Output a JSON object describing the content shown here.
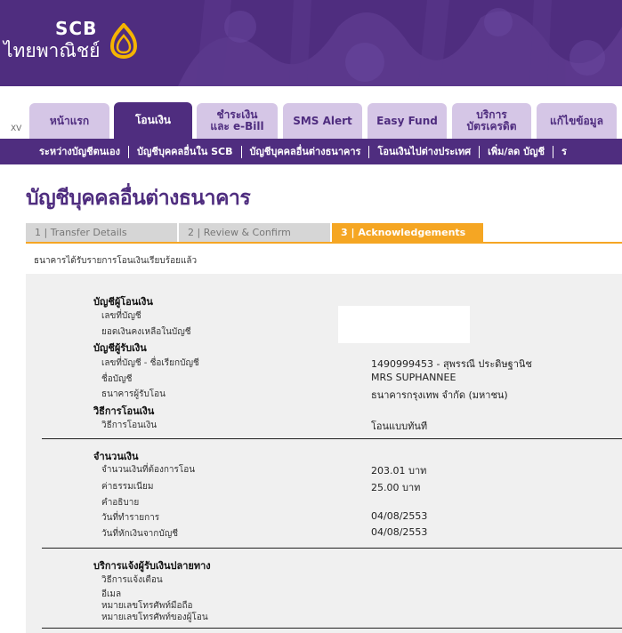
{
  "brand": {
    "name_en": "SCB",
    "name_th": "ไทยพาณิชย์",
    "purple": "#4f2d7f",
    "light_purple": "#d5c6e6",
    "orange": "#f5a623"
  },
  "tabbar": {
    "xv": "XV",
    "tabs": [
      {
        "label": "หน้าแรก"
      },
      {
        "label": "โอนเงิน"
      },
      {
        "label_line1": "ชำระเงิน",
        "label_line2": "และ e-Bill"
      },
      {
        "label": "SMS Alert"
      },
      {
        "label": "Easy Fund"
      },
      {
        "label_line1": "บริการ",
        "label_line2": "บัตรเครดิต"
      },
      {
        "label": "แก้ไขข้อมูล"
      }
    ]
  },
  "subnav": {
    "items": [
      "ระหว่างบัญชีตนเอง",
      "บัญชีบุคคลอื่นใน SCB",
      "บัญชีบุคคลอื่นต่างธนาคาร",
      "โอนเงินไปต่างประเทศ",
      "เพิ่ม/ลด บัญชี",
      "ร"
    ]
  },
  "page": {
    "title": "บัญชีบุคคลอื่นต่างธนาคาร",
    "steps": [
      "1 | Transfer Details",
      "2 | Review & Confirm",
      "3 | Acknowledgements"
    ],
    "ack_message": "ธนาคารได้รับรายการโอนเงินเรียบร้อยแล้ว"
  },
  "from_account": {
    "title": "บัญชีผู้โอนเงิน",
    "account_no_label": "เลขที่บัญชี",
    "balance_label": "ยอดเงินคงเหลือในบัญชี"
  },
  "to_account": {
    "title": "บัญชีผู้รับเงิน",
    "account_no_label": "เลขที่บัญชี - ชื่อเรียกบัญชี",
    "account_no_value": "1490999453 - สุพรรณี ประดิษฐานิช",
    "account_name_label": "ชื่อบัญชี",
    "account_name_value": "MRS SUPHANNEE",
    "bank_label": "ธนาคารผู้รับโอน",
    "bank_value": "ธนาคารกรุงเทพ จำกัด (มหาชน)"
  },
  "method": {
    "title": "วิธีการโอนเงิน",
    "label": "วิธีการโอนเงิน",
    "value": "โอนแบบทันที"
  },
  "amount": {
    "title": "จำนวนเงิน",
    "amount_label": "จำนวนเงินที่ต้องการโอน",
    "amount_value": "203.01 บาท",
    "fee_label": "ค่าธรรมเนียม",
    "fee_value": "25.00  บาท",
    "desc_label": "คำอธิบาย",
    "txn_date_label": "วันที่ทำรายการ",
    "txn_date_value": "04/08/2553",
    "debit_date_label": "วันที่หักเงินจากบัญชี",
    "debit_date_value": "04/08/2553"
  },
  "notify": {
    "title": "บริการแจ้งผู้รับเงินปลายทาง",
    "method_label": "วิธีการแจ้งเตือน",
    "email_label": "อีเมล",
    "mobile_label": "หมายเลขโทรศัพท์มือถือ",
    "sender_phone_label": "หมายเลขโทรศัพท์ของผู้โอน"
  }
}
